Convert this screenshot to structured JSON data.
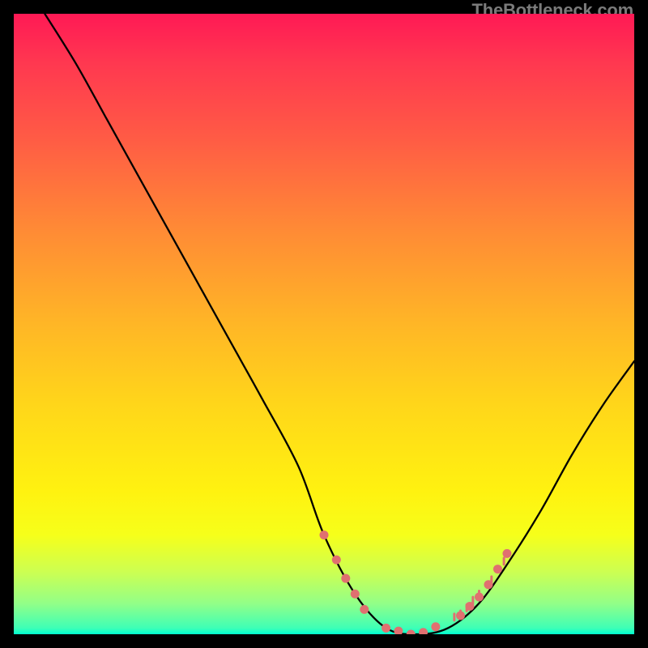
{
  "watermark": "TheBottleneck.com",
  "chart_data": {
    "type": "line",
    "title": "",
    "xlabel": "",
    "ylabel": "",
    "xlim": [
      0,
      100
    ],
    "ylim": [
      0,
      100
    ],
    "grid": false,
    "legend": false,
    "series": [
      {
        "name": "bottleneck-curve",
        "color": "#000000",
        "x": [
          5,
          10,
          15,
          20,
          25,
          30,
          35,
          40,
          45.9,
          50,
          55,
          60,
          65,
          70,
          75,
          80,
          85,
          90,
          95,
          100
        ],
        "y": [
          100,
          92,
          83,
          74,
          65,
          56,
          47,
          38,
          27,
          16,
          6.5,
          1,
          0,
          1,
          5,
          12,
          20,
          29,
          37,
          44
        ]
      },
      {
        "name": "marker-dots-left",
        "type": "scatter",
        "color": "#e07070",
        "x": [
          50,
          52,
          53.5,
          55,
          56.5
        ],
        "y": [
          16,
          12,
          9,
          6.5,
          4
        ]
      },
      {
        "name": "marker-dots-bottom",
        "type": "scatter",
        "color": "#e07070",
        "x": [
          60,
          62,
          64,
          66,
          68
        ],
        "y": [
          1,
          0.5,
          0,
          0.3,
          1.2
        ]
      },
      {
        "name": "marker-dots-right",
        "type": "scatter",
        "color": "#e07070",
        "x": [
          72,
          73.5,
          75,
          76.5,
          78,
          79.5
        ],
        "y": [
          3,
          4.5,
          6,
          8,
          10.5,
          13
        ]
      },
      {
        "name": "marker-ticks-right",
        "type": "scatter",
        "color": "#e07070",
        "x": [
          71,
          72,
          73,
          74,
          75,
          77,
          79
        ],
        "y": [
          2.5,
          3,
          4,
          5.2,
          6.2,
          8.5,
          11.5
        ]
      }
    ],
    "background_gradient": {
      "type": "vertical",
      "stops": [
        {
          "pos": 0.0,
          "color": "#ff1955"
        },
        {
          "pos": 0.08,
          "color": "#ff3850"
        },
        {
          "pos": 0.2,
          "color": "#ff5b45"
        },
        {
          "pos": 0.35,
          "color": "#ff8b35"
        },
        {
          "pos": 0.5,
          "color": "#ffb626"
        },
        {
          "pos": 0.63,
          "color": "#ffd61a"
        },
        {
          "pos": 0.77,
          "color": "#fff210"
        },
        {
          "pos": 0.84,
          "color": "#f6ff1a"
        },
        {
          "pos": 0.9,
          "color": "#ccff52"
        },
        {
          "pos": 0.95,
          "color": "#93ff87"
        },
        {
          "pos": 0.99,
          "color": "#3effb6"
        },
        {
          "pos": 1.0,
          "color": "#00ffd0"
        }
      ]
    }
  }
}
